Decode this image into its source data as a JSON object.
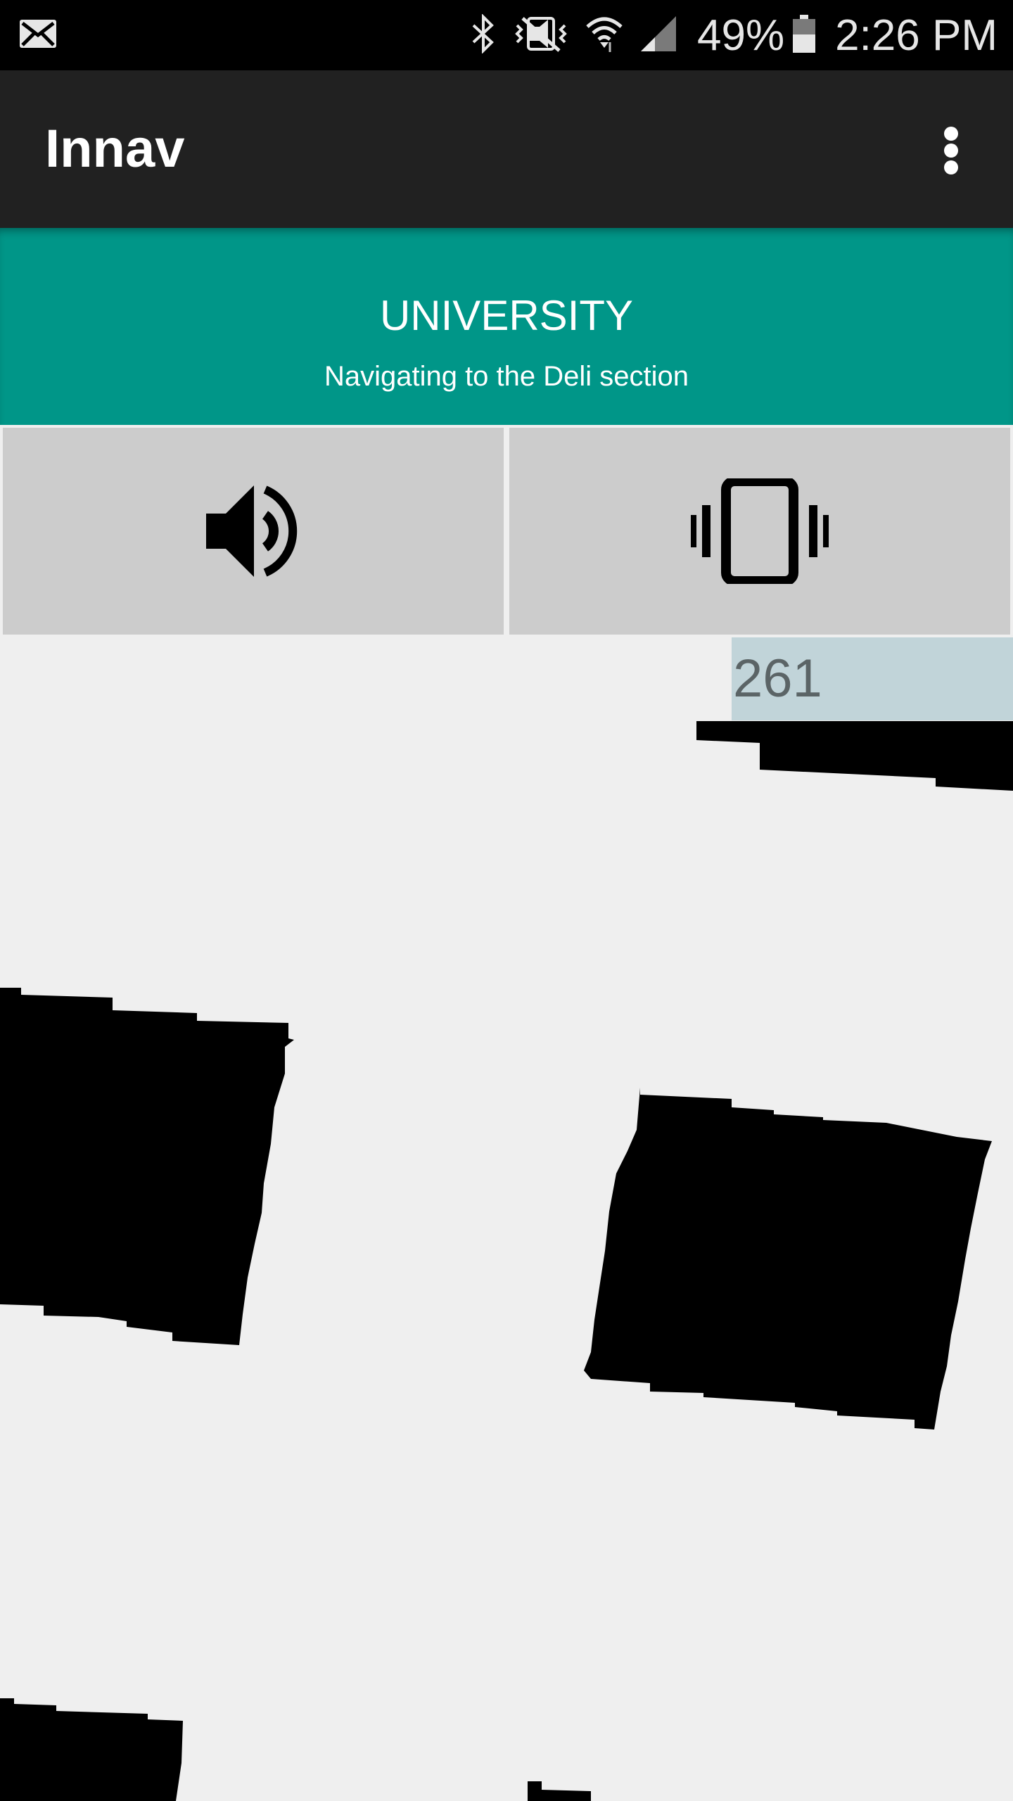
{
  "status_bar": {
    "battery_percent": "49%",
    "time": "2:26 PM",
    "icons": [
      "email-icon",
      "bluetooth-icon",
      "vibrate-mute-icon",
      "wifi-icon",
      "signal-icon",
      "battery-icon"
    ]
  },
  "app_bar": {
    "title": "Innav",
    "overflow_icon": "more-vert-icon"
  },
  "banner": {
    "title": "UNIVERSITY",
    "subtitle": "Navigating to the Deli section",
    "color": "#009688"
  },
  "mode_buttons": {
    "sound_icon": "speaker-icon",
    "vibrate_icon": "vibrate-icon"
  },
  "map": {
    "distance": "261"
  }
}
